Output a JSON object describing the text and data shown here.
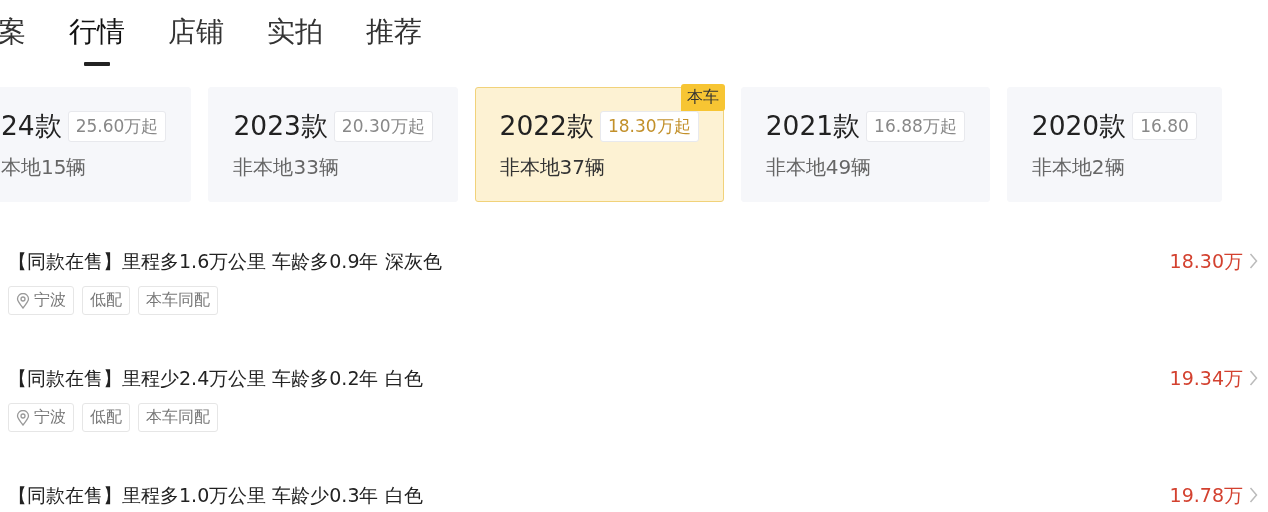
{
  "tabs": [
    {
      "label": "案",
      "selected": false
    },
    {
      "label": "行情",
      "selected": true
    },
    {
      "label": "店铺",
      "selected": false
    },
    {
      "label": "实拍",
      "selected": false
    },
    {
      "label": "推荐",
      "selected": false
    }
  ],
  "models": [
    {
      "year": "24款",
      "price": "25.60万起",
      "stock": "本地15辆",
      "selected": false
    },
    {
      "year": "2023款",
      "price": "20.30万起",
      "stock": "非本地33辆",
      "selected": false
    },
    {
      "year": "2022款",
      "price": "18.30万起",
      "stock": "非本地37辆",
      "selected": true,
      "badge": "本车"
    },
    {
      "year": "2021款",
      "price": "16.88万起",
      "stock": "非本地49辆",
      "selected": false
    },
    {
      "year": "2020款",
      "price": "16.80",
      "stock": "非本地2辆",
      "selected": false
    }
  ],
  "listings": [
    {
      "title": "【同款在售】里程多1.6万公里 车龄多0.9年 深灰色",
      "price": "18.30万",
      "tags": [
        {
          "label": "宁波",
          "kind": "location"
        },
        {
          "label": "低配",
          "kind": "plain"
        },
        {
          "label": "本车同配",
          "kind": "plain"
        }
      ]
    },
    {
      "title": "【同款在售】里程少2.4万公里 车龄多0.2年 白色",
      "price": "19.34万",
      "tags": [
        {
          "label": "宁波",
          "kind": "location"
        },
        {
          "label": "低配",
          "kind": "plain"
        },
        {
          "label": "本车同配",
          "kind": "plain"
        }
      ]
    },
    {
      "title": "【同款在售】里程多1.0万公里 车龄少0.3年 白色",
      "price": "19.78万"
    }
  ]
}
